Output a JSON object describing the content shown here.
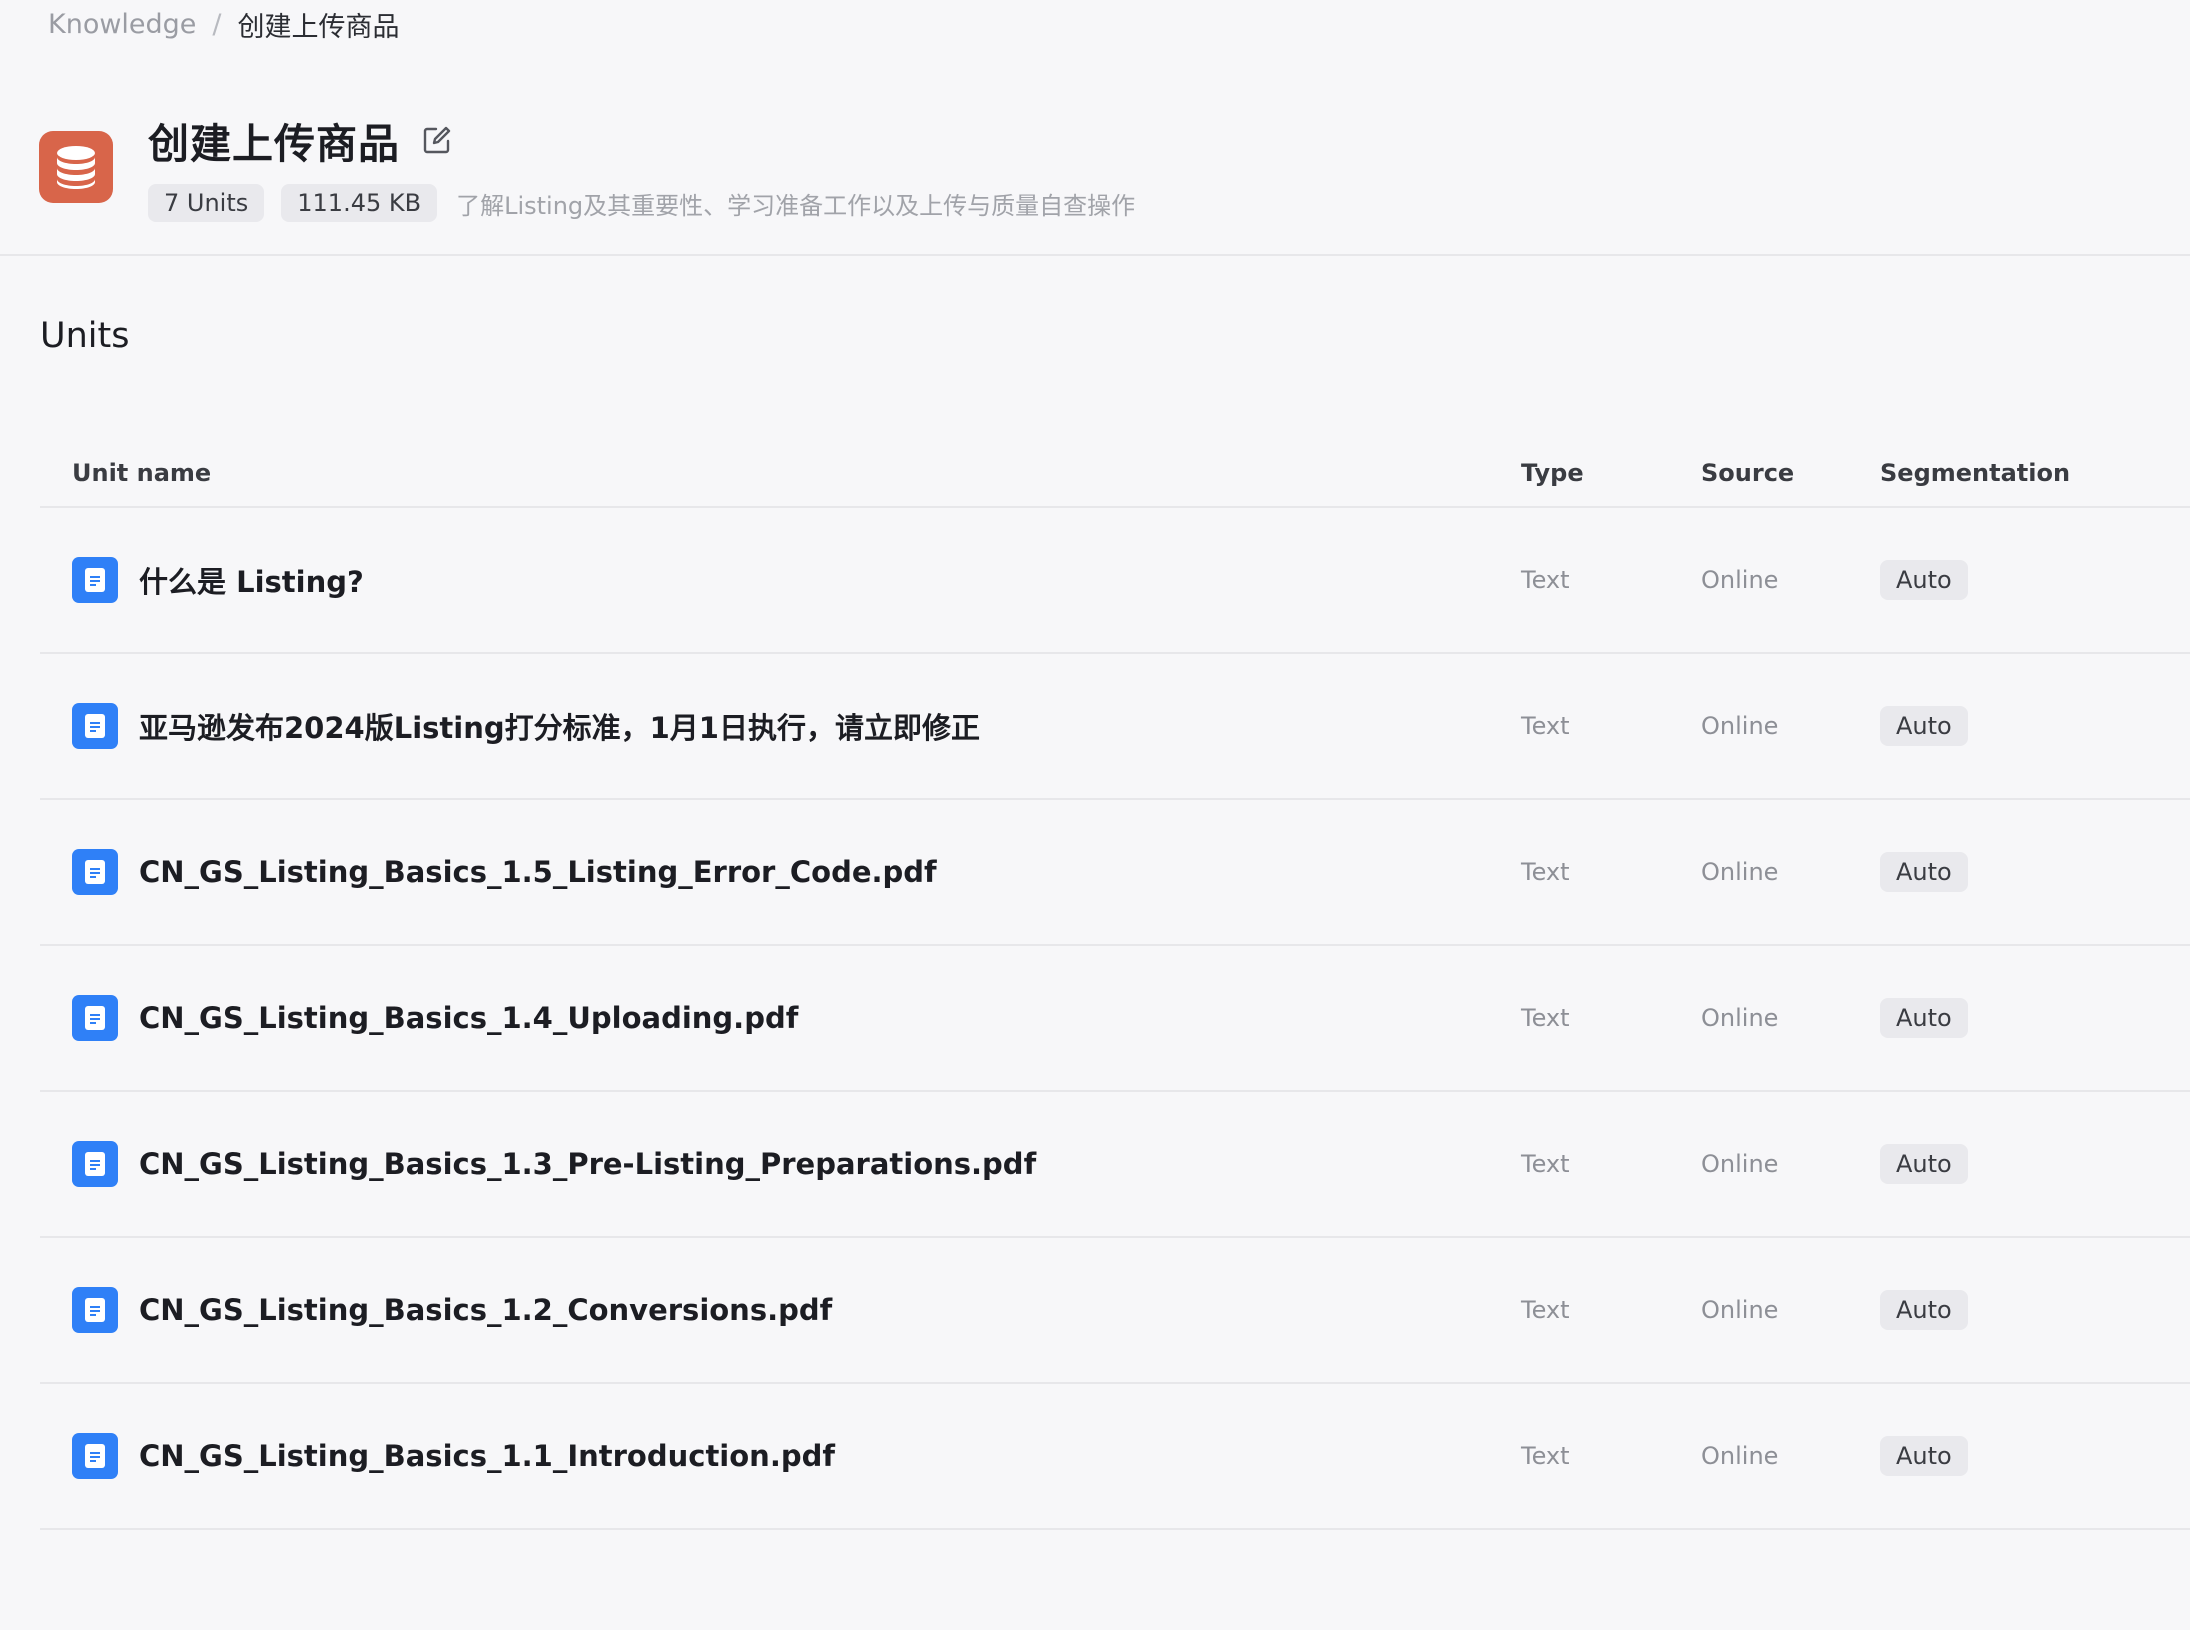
{
  "breadcrumb": {
    "root": "Knowledge",
    "separator": "/",
    "current": "创建上传商品"
  },
  "header": {
    "title": "创建上传商品",
    "units_badge": "7 Units",
    "size_badge": "111.45 KB",
    "description": "了解Listing及其重要性、学习准备工作以及上传与质量自查操作",
    "logo_icon": "database-icon",
    "edit_icon": "edit-icon"
  },
  "section_title": "Units",
  "table": {
    "columns": {
      "name": "Unit name",
      "type": "Type",
      "source": "Source",
      "segmentation": "Segmentation"
    },
    "rows": [
      {
        "name": "什么是 Listing?",
        "type": "Text",
        "source": "Online",
        "segmentation": "Auto"
      },
      {
        "name": "亚马逊发布2024版Listing打分标准，1月1日执行，请立即修正",
        "type": "Text",
        "source": "Online",
        "segmentation": "Auto"
      },
      {
        "name": "CN_GS_Listing_Basics_1.5_Listing_Error_Code.pdf",
        "type": "Text",
        "source": "Online",
        "segmentation": "Auto"
      },
      {
        "name": "CN_GS_Listing_Basics_1.4_Uploading.pdf",
        "type": "Text",
        "source": "Online",
        "segmentation": "Auto"
      },
      {
        "name": "CN_GS_Listing_Basics_1.3_Pre-Listing_Preparations.pdf",
        "type": "Text",
        "source": "Online",
        "segmentation": "Auto"
      },
      {
        "name": "CN_GS_Listing_Basics_1.2_Conversions.pdf",
        "type": "Text",
        "source": "Online",
        "segmentation": "Auto"
      },
      {
        "name": "CN_GS_Listing_Basics_1.1_Introduction.pdf",
        "type": "Text",
        "source": "Online",
        "segmentation": "Auto"
      }
    ]
  },
  "colors": {
    "logo_bg": "#d8654a",
    "file_icon_bg": "#2f80f7",
    "badge_bg": "#e9e9ed",
    "page_bg": "#f7f7f9"
  }
}
